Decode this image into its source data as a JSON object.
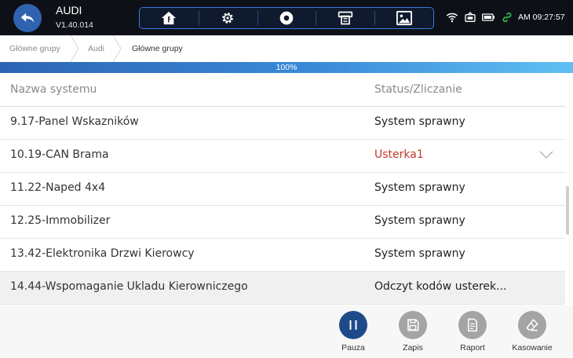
{
  "header": {
    "title": "AUDI",
    "version": "V1.40.014",
    "toolbar": [
      "home-icon",
      "settings-icon",
      "record-icon",
      "printer-icon",
      "image-icon"
    ],
    "status_icons": [
      "wifi-icon",
      "vci-icon",
      "battery-icon",
      "link-icon"
    ],
    "clock": "AM 09:27:57",
    "accent_color": "#3a78d6",
    "link_color": "#35c24a"
  },
  "breadcrumb": [
    "Główne grupy",
    "Audi",
    "Główne grupy"
  ],
  "progress": {
    "value": 1.0,
    "label": "100%"
  },
  "table": {
    "columns": [
      "Nazwa systemu",
      "Status/Zliczanie"
    ],
    "rows": [
      {
        "name": "9.17-Panel Wskazników",
        "status": "System sprawny",
        "fault": false
      },
      {
        "name": "10.19-CAN Brama",
        "status": "Usterka1",
        "fault": true,
        "expandable": true
      },
      {
        "name": "11.22-Naped 4x4",
        "status": "System sprawny",
        "fault": false
      },
      {
        "name": "12.25-Immobilizer",
        "status": "System sprawny",
        "fault": false
      },
      {
        "name": "13.42-Elektronika Drzwi Kierowcy",
        "status": "System sprawny",
        "fault": false
      },
      {
        "name": "14.44-Wspomaganie Ukladu Kierowniczego",
        "status": "Odczyt kodów usterek...",
        "fault": false,
        "active": true
      }
    ],
    "fault_color": "#c0392b"
  },
  "actions": [
    {
      "label": "Pauza",
      "icon": "pause-icon"
    },
    {
      "label": "Zapis",
      "icon": "save-icon"
    },
    {
      "label": "Raport",
      "icon": "report-icon"
    },
    {
      "label": "Kasowanie",
      "icon": "erase-icon"
    }
  ]
}
